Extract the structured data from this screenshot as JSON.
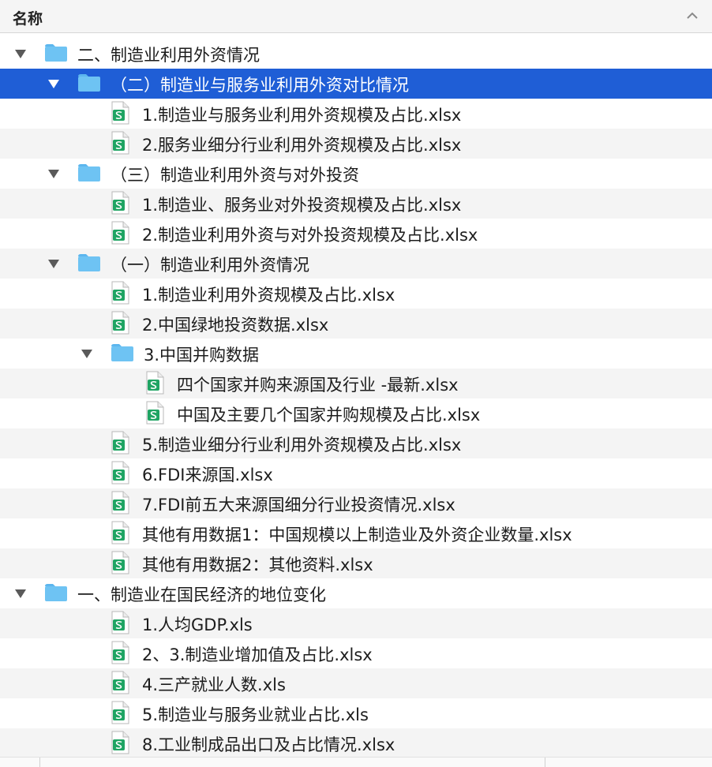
{
  "header": {
    "column_name": "名称",
    "sort_icon": "chevron-up-icon"
  },
  "rows": [
    {
      "label": "二、制造业利用外资情况",
      "type": "folder",
      "level": 0,
      "expanded": true
    },
    {
      "label": "（二）制造业与服务业利用外资对比情况",
      "type": "folder",
      "level": 1,
      "expanded": true,
      "selected": true
    },
    {
      "label": "1.制造业与服务业利用外资规模及占比.xlsx",
      "type": "file",
      "level": 2
    },
    {
      "label": "2.服务业细分行业利用外资规模及占比.xlsx",
      "type": "file",
      "level": 2
    },
    {
      "label": "（三）制造业利用外资与对外投资",
      "type": "folder",
      "level": 1,
      "expanded": true
    },
    {
      "label": "1.制造业、服务业对外投资规模及占比.xlsx",
      "type": "file",
      "level": 2
    },
    {
      "label": "2.制造业利用外资与对外投资规模及占比.xlsx",
      "type": "file",
      "level": 2
    },
    {
      "label": "（一）制造业利用外资情况",
      "type": "folder",
      "level": 1,
      "expanded": true
    },
    {
      "label": "1.制造业利用外资规模及占比.xlsx",
      "type": "file",
      "level": 2
    },
    {
      "label": "2.中国绿地投资数据.xlsx",
      "type": "file",
      "level": 2
    },
    {
      "label": "3.中国并购数据",
      "type": "folder",
      "level": 2,
      "expanded": true
    },
    {
      "label": "四个国家并购来源国及行业 -最新.xlsx",
      "type": "file",
      "level": 3
    },
    {
      "label": "中国及主要几个国家并购规模及占比.xlsx",
      "type": "file",
      "level": 3
    },
    {
      "label": "5.制造业细分行业利用外资规模及占比.xlsx",
      "type": "file",
      "level": 2
    },
    {
      "label": "6.FDI来源国.xlsx",
      "type": "file",
      "level": 2
    },
    {
      "label": "7.FDI前五大来源国细分行业投资情况.xlsx",
      "type": "file",
      "level": 2
    },
    {
      "label": "其他有用数据1：中国规模以上制造业及外资企业数量.xlsx",
      "type": "file",
      "level": 2
    },
    {
      "label": "其他有用数据2：其他资料.xlsx",
      "type": "file",
      "level": 2
    },
    {
      "label": "一、制造业在国民经济的地位变化",
      "type": "folder",
      "level": 0,
      "expanded": true
    },
    {
      "label": "1.人均GDP.xls",
      "type": "file",
      "level": 1
    },
    {
      "label": "2、3.制造业增加值及占比.xlsx",
      "type": "file",
      "level": 1
    },
    {
      "label": "4.三产就业人数.xls",
      "type": "file",
      "level": 1
    },
    {
      "label": "5.制造业与服务业就业占比.xls",
      "type": "file",
      "level": 1
    },
    {
      "label": "8.工业制成品出口及占比情况.xlsx",
      "type": "file",
      "level": 1
    }
  ],
  "colors": {
    "selection": "#1f5ed6",
    "folder": "#6ec3f3",
    "spreadsheet": "#1fa463"
  }
}
